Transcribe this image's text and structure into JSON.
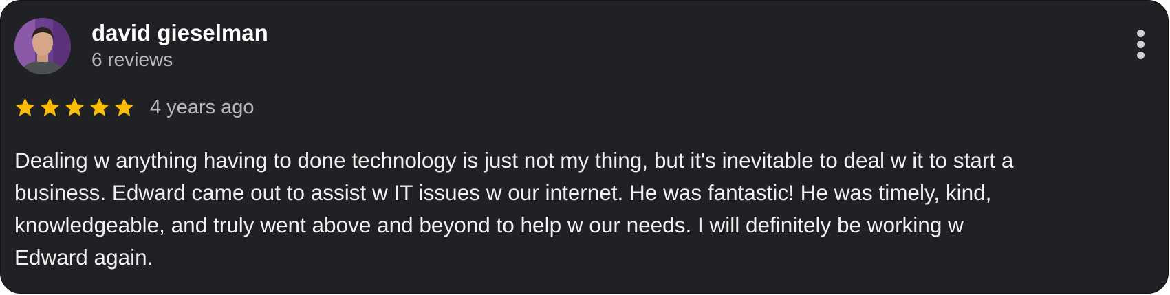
{
  "review": {
    "author": "david gieselman",
    "review_count": "6 reviews",
    "rating": 5,
    "rating_max": 5,
    "time_ago": "4 years ago",
    "text_lines": [
      "Dealing w anything having to done technology is just not my thing, but it's inevitable to deal w it to start a",
      "business. Edward came out to assist w IT issues w our internet. He was fantastic! He was timely, kind,",
      "knowledgeable, and truly went above and beyond to help w our needs. I will definitely be working w",
      "Edward again."
    ]
  },
  "icons": {
    "avatar": "user-photo",
    "more": "more-vert-icon",
    "star": "star-icon"
  },
  "colors": {
    "card_background": "#202124",
    "star": "#fbbc04",
    "muted_text": "#b6b8bb"
  }
}
